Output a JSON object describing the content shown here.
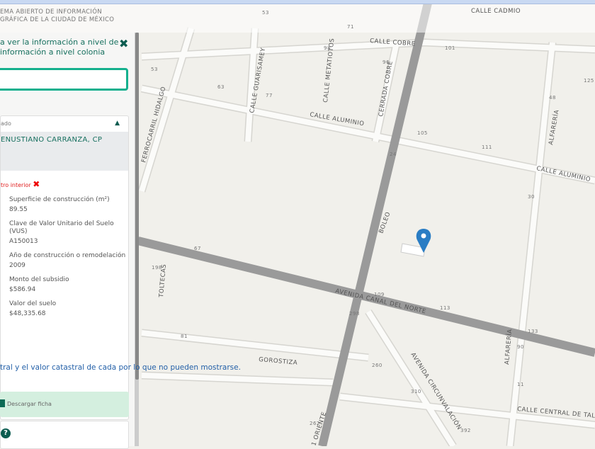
{
  "header": {
    "brand_line1": "EMA ABIERTO DE INFORMACIÓN",
    "brand_line2": "GRÁFICA DE LA CIUDAD DE MÉXICO"
  },
  "panel": {
    "hint": "a ver la información a nivel de información a nivel colonia",
    "search_value": "",
    "result_header": "ado",
    "result_value": "ENUSTIANO CARRANZA, CP",
    "subtitle": "tro interior",
    "fields": [
      {
        "label": "Superficie de construcción (m²)",
        "value": "89.55"
      },
      {
        "label": "Clave de Valor Unitario del Suelo (VUS)",
        "value": "A150013"
      },
      {
        "label": "Año de construcción o remodelación",
        "value": "2009"
      },
      {
        "label": "Monto del subsidio",
        "value": "$586.94"
      },
      {
        "label": "Valor del suelo",
        "value": "$48,335.68"
      }
    ],
    "note": "tral y el valor catastral de cada por lo que no pueden mostrarse.",
    "download": "Descargar ficha"
  },
  "map": {
    "streets": {
      "cadmio": "CALLE CADMIO",
      "cobre": "CALLE COBRE",
      "aluminio": "CALLE ALUMINIO",
      "aluminio2": "CALLE ALUMINIO",
      "guarisamey": "CALLE GUARISAMEY",
      "metatiotos": "CALLE METATIOTOS",
      "cerrada": "CERRADA COBRE",
      "ferrocarril": "FERROCARRIL HIDALGO",
      "alfareria": "ALFARERÍA",
      "alfareria2": "ALFARERÍA",
      "boleo": "BOLEO",
      "canal": "AVENIDA CANAL DEL NORTE",
      "toltecas": "TOLTECAS",
      "gorostiza": "GOROSTIZA",
      "circunvalacion": "AVENIDA CIRCUNVALACIÓN",
      "central": "CALLE CENTRAL DE TAL",
      "oriente": "1 ORIENTE"
    },
    "numbers": [
      "53",
      "71",
      "101",
      "125",
      "98",
      "96",
      "77",
      "63",
      "53",
      "105",
      "111",
      "24",
      "48",
      "30",
      "67",
      "109",
      "113",
      "133",
      "198",
      "298",
      "260",
      "310",
      "81",
      "90",
      "11",
      "262",
      "392"
    ]
  }
}
